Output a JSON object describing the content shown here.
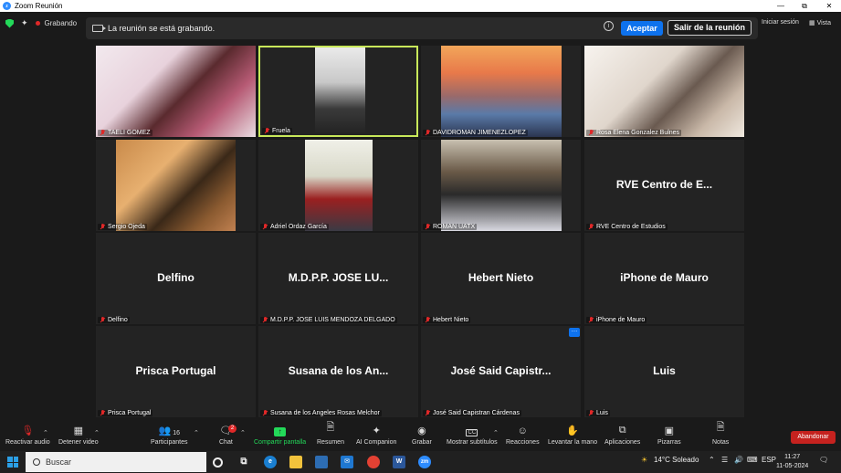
{
  "window": {
    "title": "Zoom Reunión"
  },
  "status": {
    "recording_label": "Grabando"
  },
  "banner": {
    "text": "La reunión se está grabando.",
    "accept_label": "Aceptar",
    "leave_label": "Salir de la reunión"
  },
  "header": {
    "signin_label": "Iniciar sesión",
    "view_label": "Vista"
  },
  "participants": [
    {
      "name": "TAELI GOMEZ",
      "label": "TAELI GOMEZ",
      "video": true
    },
    {
      "name": "Fruela",
      "label": "Fruela",
      "video": true,
      "active": true
    },
    {
      "name": "DAVIDROMAN JIMENEZLOPEZ",
      "label": "DAVIDROMAN JIMENEZLOPEZ",
      "video": true
    },
    {
      "name": "Rosa Elena Gonzalez Bulnes",
      "label": "Rosa Elena Gonzalez Bulnes",
      "video": true
    },
    {
      "name": "Sergio Ojeda",
      "label": "Sergio Ojeda",
      "video": true
    },
    {
      "name": "Adriel Ordaz García",
      "label": "Adriel Ordaz García",
      "video": true
    },
    {
      "name": "ROMAN UATX",
      "label": "ROMAN UATX",
      "video": true
    },
    {
      "name": "RVE Centro de E...",
      "label": "RVE Centro de Estudios",
      "video": false
    },
    {
      "name": "Delfino",
      "label": "Delfino",
      "video": false
    },
    {
      "name": "M.D.P.P. JOSE LU...",
      "label": "M.D.P.P. JOSE LUIS MENDOZA DELGADO",
      "video": false
    },
    {
      "name": "Hebert Nieto",
      "label": "Hebert Nieto",
      "video": false
    },
    {
      "name": "iPhone de Mauro",
      "label": "iPhone de Mauro",
      "video": false
    },
    {
      "name": "Prisca Portugal",
      "label": "Prisca Portugal",
      "video": false
    },
    {
      "name": "Susana de los An...",
      "label": "Susana de los Angeles Rosas Melchor",
      "video": false
    },
    {
      "name": "José Said Capistr...",
      "label": "José Said Capistran Cárdenas",
      "video": false
    },
    {
      "name": "Luis",
      "label": "Luis",
      "video": false
    }
  ],
  "toolbar": {
    "unmute": "Reactivar audio",
    "stop_video": "Detener video",
    "participants": "Participantes",
    "participants_count": "16",
    "chat": "Chat",
    "chat_badge": "2",
    "share": "Compartir pantalla",
    "summary": "Resumen",
    "ai": "AI Companion",
    "record": "Grabar",
    "captions": "Mostrar subtítulos",
    "reactions": "Reacciones",
    "raise_hand": "Levantar la mano",
    "apps": "Aplicaciones",
    "whiteboards": "Pizarras",
    "notes": "Notas",
    "end": "Abandonar"
  },
  "taskbar": {
    "search_placeholder": "Buscar",
    "weather": "14°C  Soleado",
    "lang": "ESP",
    "time": "11:27",
    "date": "11-05-2024"
  }
}
